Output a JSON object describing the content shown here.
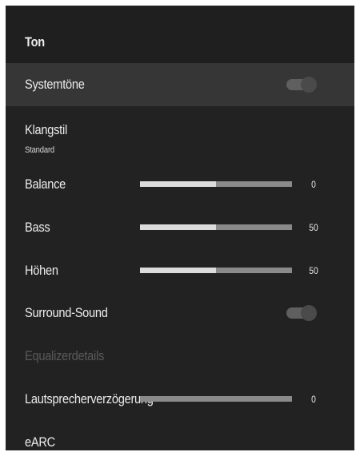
{
  "header": {
    "title": "Ton"
  },
  "items": [
    {
      "label": "Systemtöne",
      "type": "toggle",
      "on": true,
      "selected": true
    },
    {
      "label": "Klangstil",
      "sublabel": "Standard",
      "type": "menu"
    },
    {
      "label": "Balance",
      "type": "slider",
      "value": "0",
      "fill_fraction": 0.5
    },
    {
      "label": "Bass",
      "type": "slider",
      "value": "50",
      "fill_fraction": 0.5
    },
    {
      "label": "Höhen",
      "type": "slider",
      "value": "50",
      "fill_fraction": 0.5
    },
    {
      "label": "Surround-Sound",
      "type": "toggle",
      "on": true
    },
    {
      "label": "Equalizerdetails",
      "type": "menu",
      "disabled": true
    },
    {
      "label": "Lautsprecherverzögerung",
      "type": "slider",
      "value": "0",
      "fill_fraction": 0
    },
    {
      "label": "eARC",
      "type": "menu"
    }
  ],
  "colors": {
    "panel_bg": "#222222",
    "selected_row_bg": "#363636",
    "slider_fill": "#dcdcdc",
    "slider_track": "#8a8a8a",
    "disabled_text": "#5a5a5a"
  }
}
